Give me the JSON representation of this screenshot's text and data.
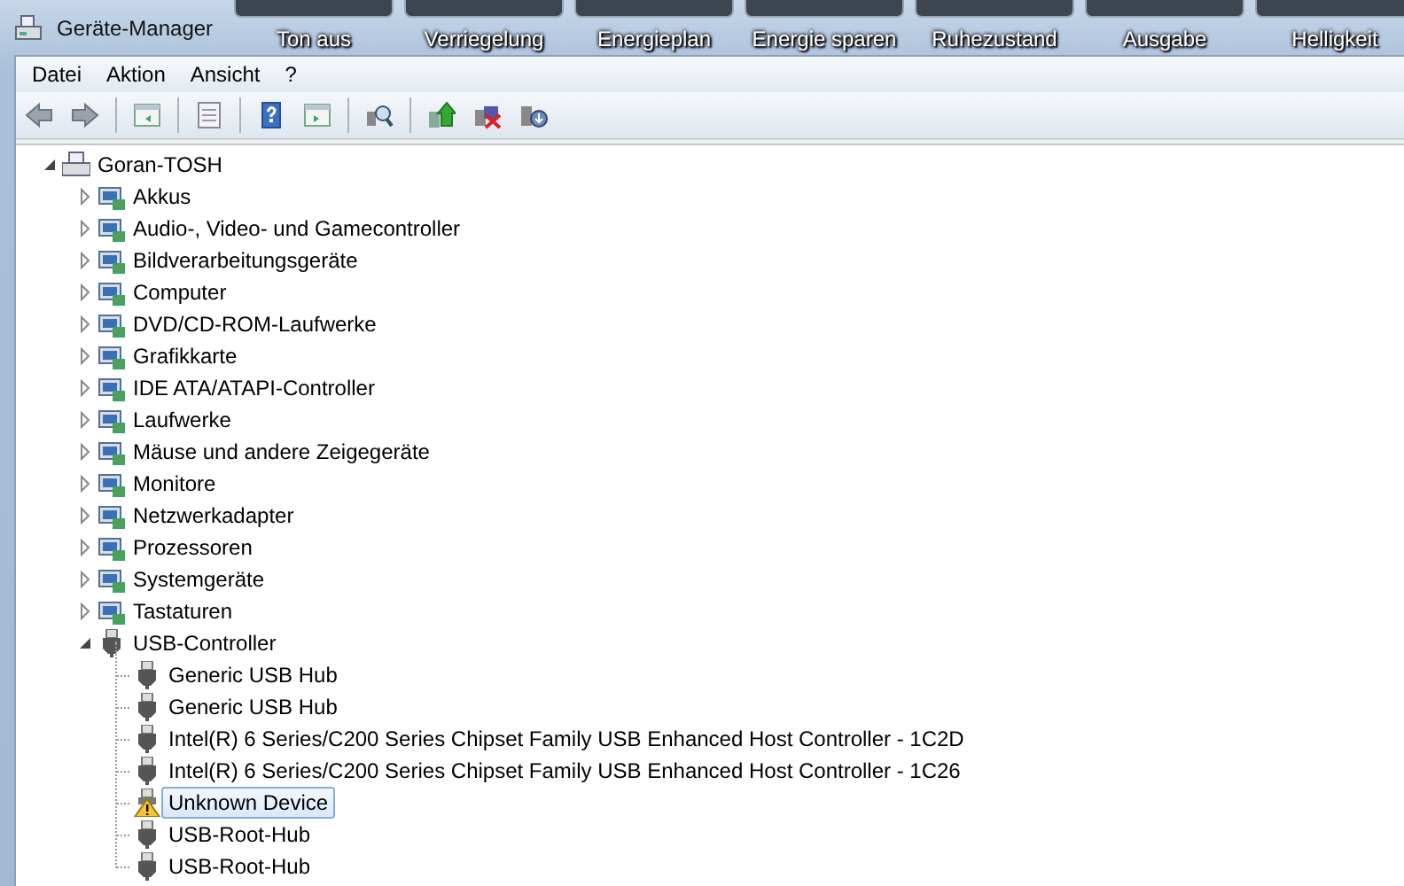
{
  "window": {
    "title": "Geräte-Manager"
  },
  "overlay_buttons": [
    "Ton aus",
    "Verriegelung",
    "Energieplan",
    "Energie sparen",
    "Ruhezustand",
    "Ausgabe",
    "Helligkeit"
  ],
  "menu": [
    "Datei",
    "Aktion",
    "Ansicht",
    "?"
  ],
  "tree": {
    "label": "Goran-TOSH",
    "expanded": true,
    "children": [
      {
        "label": "Akkus",
        "expanded": false,
        "selected": false
      },
      {
        "label": "Audio-, Video- und Gamecontroller",
        "expanded": false,
        "selected": false
      },
      {
        "label": "Bildverarbeitungsgeräte",
        "expanded": false,
        "selected": false
      },
      {
        "label": "Computer",
        "expanded": false,
        "selected": false
      },
      {
        "label": "DVD/CD-ROM-Laufwerke",
        "expanded": false,
        "selected": false
      },
      {
        "label": "Grafikkarte",
        "expanded": false,
        "selected": false
      },
      {
        "label": "IDE ATA/ATAPI-Controller",
        "expanded": false,
        "selected": false
      },
      {
        "label": "Laufwerke",
        "expanded": false,
        "selected": false
      },
      {
        "label": "Mäuse und andere Zeigegeräte",
        "expanded": false,
        "selected": false
      },
      {
        "label": "Monitore",
        "expanded": false,
        "selected": false
      },
      {
        "label": "Netzwerkadapter",
        "expanded": false,
        "selected": false
      },
      {
        "label": "Prozessoren",
        "expanded": false,
        "selected": false
      },
      {
        "label": "Systemgeräte",
        "expanded": false,
        "selected": false
      },
      {
        "label": "Tastaturen",
        "expanded": false,
        "selected": false
      },
      {
        "label": "USB-Controller",
        "expanded": true,
        "selected": false,
        "children": [
          {
            "label": "Generic USB Hub",
            "selected": false,
            "warning": false
          },
          {
            "label": "Generic USB Hub",
            "selected": false,
            "warning": false
          },
          {
            "label": "Intel(R) 6 Series/C200 Series Chipset Family USB Enhanced Host Controller - 1C2D",
            "selected": false,
            "warning": false
          },
          {
            "label": "Intel(R) 6 Series/C200 Series Chipset Family USB Enhanced Host Controller - 1C26",
            "selected": false,
            "warning": false
          },
          {
            "label": "Unknown Device",
            "selected": true,
            "warning": true
          },
          {
            "label": "USB-Root-Hub",
            "selected": false,
            "warning": false
          },
          {
            "label": "USB-Root-Hub",
            "selected": false,
            "warning": false
          }
        ]
      }
    ]
  }
}
